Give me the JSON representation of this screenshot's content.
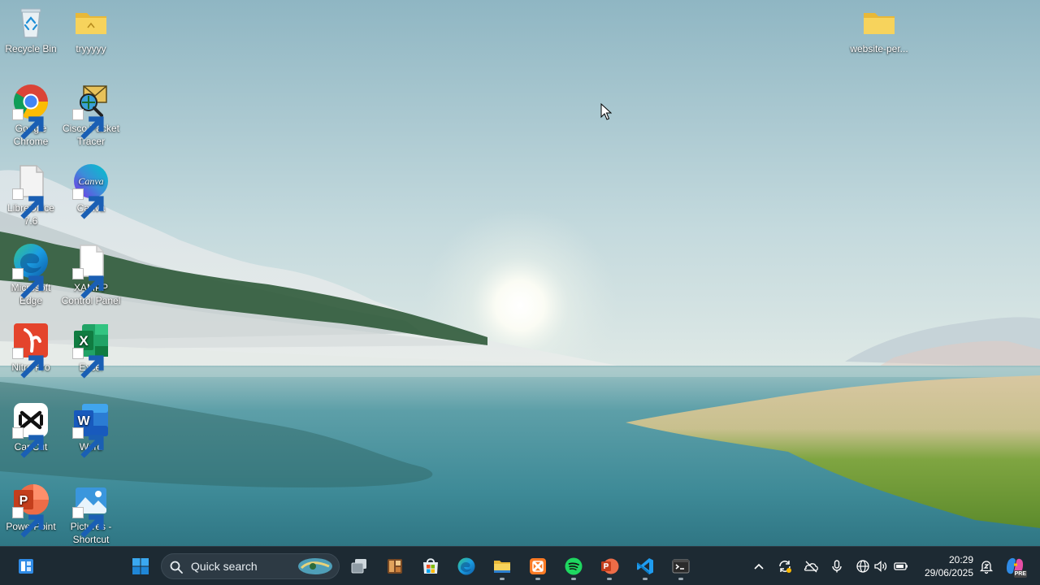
{
  "desktop": {
    "icons": [
      {
        "label": "Recycle Bin",
        "icon": "recycle-bin-icon"
      },
      {
        "label": "tryyyyy",
        "icon": "folder-icon"
      },
      {
        "label": "Google Chrome",
        "icon": "chrome-icon"
      },
      {
        "label": "Cisco Packet Tracer",
        "icon": "cisco-packet-tracer-icon"
      },
      {
        "label": "LibreOffice 7.6",
        "icon": "libreoffice-icon"
      },
      {
        "label": "Canva",
        "icon": "canva-icon",
        "glyph": "Canva"
      },
      {
        "label": "Microsoft Edge",
        "icon": "edge-icon"
      },
      {
        "label": "XAMPP Control Panel",
        "icon": "xampp-icon"
      },
      {
        "label": "Nitro Pro",
        "icon": "nitro-pro-icon"
      },
      {
        "label": "Excel",
        "icon": "excel-icon",
        "glyph": "X"
      },
      {
        "label": "CapCut",
        "icon": "capcut-icon"
      },
      {
        "label": "Word",
        "icon": "word-icon",
        "glyph": "W"
      },
      {
        "label": "PowerPoint",
        "icon": "powerpoint-icon",
        "glyph": "P"
      },
      {
        "label": "Pictures - Shortcut",
        "icon": "pictures-icon"
      },
      {
        "label": "website-per...",
        "icon": "folder-icon"
      }
    ]
  },
  "taskbar": {
    "search_placeholder": "Quick search",
    "apps": [
      "start-menu-icon",
      "task-view-icon",
      "widgets-icon",
      "microsoft-store-icon",
      "edge-icon",
      "file-explorer-icon",
      "xampp-icon",
      "spotify-icon",
      "powerpoint-icon",
      "vscode-icon",
      "terminal-icon"
    ],
    "tray": [
      "show-hidden-icons-chevron",
      "sync-icon",
      "onedrive-icon",
      "microphone-icon",
      "network-icon",
      "volume-icon",
      "battery-icon"
    ],
    "clock": {
      "time": "20:29",
      "date": "29/06/2025"
    },
    "copilot_badge": "PRE"
  },
  "colors": {
    "taskbar_bg": "#1d2a33",
    "sky_top": "#8fb6c3",
    "water": "#3e8a97",
    "accent": "#0a6cd6"
  }
}
